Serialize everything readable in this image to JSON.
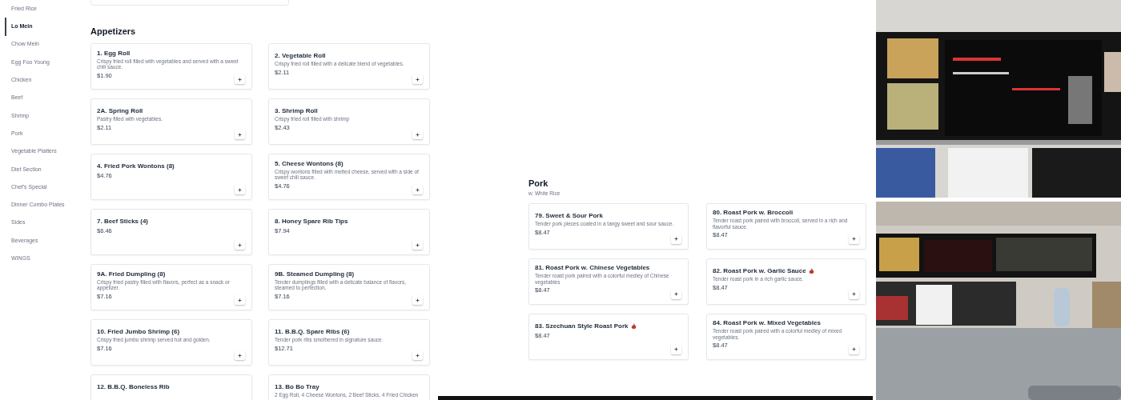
{
  "sidebar": {
    "items": [
      {
        "label": "Fried Rice",
        "selected": false
      },
      {
        "label": "Lo Mein",
        "selected": true
      },
      {
        "label": "Chow Mein",
        "selected": false
      },
      {
        "label": "Egg Foo Young",
        "selected": false
      },
      {
        "label": "Chicken",
        "selected": false
      },
      {
        "label": "Beef",
        "selected": false
      },
      {
        "label": "Shrimp",
        "selected": false
      },
      {
        "label": "Pork",
        "selected": false
      },
      {
        "label": "Vegetable Platters",
        "selected": false
      },
      {
        "label": "Diet Section",
        "selected": false
      },
      {
        "label": "Chef's Special",
        "selected": false
      },
      {
        "label": "Dinner Combo Plates",
        "selected": false
      },
      {
        "label": "Sides",
        "selected": false
      },
      {
        "label": "Beverages",
        "selected": false
      },
      {
        "label": "WINGS",
        "selected": false
      }
    ]
  },
  "sections": [
    {
      "title": "Appetizers",
      "items": [
        {
          "name": "1. Egg Roll",
          "description": "Crispy fried roll filled with vegetables and served with a sweet chili sauce.",
          "price": "$1.90",
          "spicy": false
        },
        {
          "name": "2. Vegetable Roll",
          "description": "Crispy fried roll filled with a delicate blend of vegetables.",
          "price": "$2.11",
          "spicy": false
        },
        {
          "name": "2A. Spring Roll",
          "description": "Pastry filled with vegetables.",
          "price": "$2.11",
          "spicy": false
        },
        {
          "name": "3. Shrimp Roll",
          "description": "Crispy fried roll filled with shrimp",
          "price": "$2.43",
          "spicy": false
        },
        {
          "name": "4. Fried Pork Wontons (8)",
          "price": "$4.76",
          "spicy": false
        },
        {
          "name": "5. Cheese Wontons (8)",
          "description": "Crispy wontons filled with melted cheese, served with a side of sweet chili sauce.",
          "price": "$4.76",
          "spicy": false
        },
        {
          "name": "7. Beef Sticks (4)",
          "price": "$6.46",
          "spicy": false
        },
        {
          "name": "8. Honey Spare Rib Tips",
          "price": "$7.94",
          "spicy": false
        },
        {
          "name": "9A. Fried Dumpling (8)",
          "description": "Crispy fried pastry filled with flavors, perfect as a snack or appetizer.",
          "price": "$7.16",
          "spicy": false
        },
        {
          "name": "9B. Steamed Dumpling (8)",
          "description": "Tender dumplings filled with a delicate balance of flavors, steamed to perfection.",
          "price": "$7.16",
          "spicy": false
        },
        {
          "name": "10. Fried Jumbo Shrimp (6)",
          "description": "Crispy fried jumbo shrimp served hot and golden.",
          "price": "$7.16",
          "spicy": false
        },
        {
          "name": "11. B.B.Q. Spare Ribs (6)",
          "description": "Tender pork ribs smothered in signature sauce.",
          "price": "$12.71",
          "spicy": false
        },
        {
          "name": "12. B.B.Q. Boneless Rib",
          "spicy": false
        },
        {
          "name": "13. Bo Bo Tray",
          "description": "2 Egg Roll, 4 Cheese Wontons, 2 Beef Sticks, 4 Fried Chicken",
          "spicy": false
        }
      ]
    },
    {
      "title": "Pork",
      "subtitle": "w. White Rice",
      "items": [
        {
          "name": "79. Sweet & Sour Pork",
          "description": "Tender pork pieces coated in a tangy sweet and sour sauce.",
          "price": "$8.47",
          "spicy": false
        },
        {
          "name": "80. Roast Pork w. Broccoli",
          "description": "Tender roast pork paired with broccoli, served in a rich and flavorful sauce.",
          "price": "$8.47",
          "spicy": false
        },
        {
          "name": "81. Roast Pork w. Chinese Vegetables",
          "description": "Tender roast pork paired with a colorful medley of Chinese vegetables",
          "price": "$8.47",
          "spicy": false
        },
        {
          "name": "82. Roast Pork w. Garlic Sauce",
          "description": "Tender roast pork in a rich garlic sauce.",
          "price": "$8.47",
          "spicy": true
        },
        {
          "name": "83. Szechuan Style Roast Pork",
          "price": "$8.47",
          "spicy": true
        },
        {
          "name": "84. Roast Pork w. Mixed Vegetables",
          "description": "Tender roast pork paired with a colorful medley of mixed vegetables.",
          "price": "$8.47",
          "spicy": false
        }
      ]
    }
  ]
}
